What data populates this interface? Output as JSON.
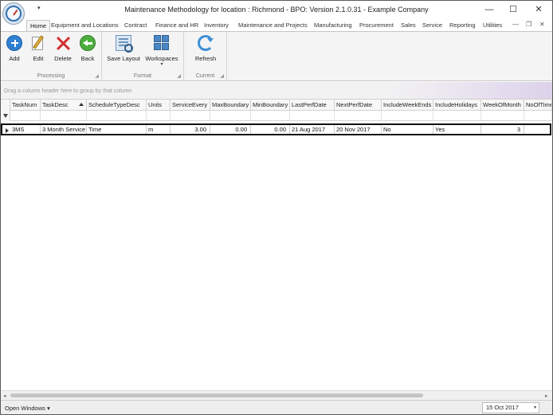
{
  "window": {
    "title": "Maintenance Methodology for location : Richmond - BPO: Version 2.1.0.31 - Example Company",
    "qat_glyph": "▾",
    "controls": {
      "minimize": "—",
      "maximize": "☐",
      "close": "✕"
    }
  },
  "ribbon": {
    "tabs": [
      {
        "label": "Home",
        "active": true
      },
      {
        "label": "Equipment and Locations"
      },
      {
        "label": "Contract"
      },
      {
        "label": "Finance and HR"
      },
      {
        "label": "Inventory"
      },
      {
        "label": "Maintenance and Projects"
      },
      {
        "label": "Manufacturing"
      },
      {
        "label": "Procurement"
      },
      {
        "label": "Sales"
      },
      {
        "label": "Service"
      },
      {
        "label": "Reporting"
      },
      {
        "label": "Utilities"
      }
    ],
    "mdi_controls": {
      "minimize": "—",
      "restore": "❐",
      "close": "✕"
    },
    "groups": {
      "processing": {
        "label": "Processing",
        "buttons": {
          "add": "Add",
          "edit": "Edit",
          "delete": "Delete",
          "back": "Back"
        }
      },
      "format": {
        "label": "Format",
        "buttons": {
          "save_layout": "Save Layout",
          "workspaces": "Workspaces"
        }
      },
      "current": {
        "label": "Current",
        "buttons": {
          "refresh": "Refresh"
        }
      }
    }
  },
  "grid": {
    "group_prompt": "Drag a column header here to group by that column",
    "columns": [
      {
        "key": "tasknum",
        "label": "TaskNum"
      },
      {
        "key": "taskdesc",
        "label": "TaskDesc",
        "sorted": "asc"
      },
      {
        "key": "scheduletype",
        "label": "ScheduleTypeDesc"
      },
      {
        "key": "units",
        "label": "Units"
      },
      {
        "key": "serviceevery",
        "label": "ServiceEvery"
      },
      {
        "key": "maxboundary",
        "label": "MaxBoundary"
      },
      {
        "key": "minboundary",
        "label": "MinBoundary"
      },
      {
        "key": "lastperf",
        "label": "LastPerfDate"
      },
      {
        "key": "nextperf",
        "label": "NextPerfDate"
      },
      {
        "key": "weekends",
        "label": "IncludeWeekEnds"
      },
      {
        "key": "holidays",
        "label": "IncludeHolidays"
      },
      {
        "key": "weekofmonth",
        "label": "WeekOfMonth"
      },
      {
        "key": "nooftimes",
        "label": "NoOfTime"
      }
    ],
    "rows": [
      {
        "cells": [
          "3MS",
          "3 Month Service",
          "Time",
          "m",
          "3.00",
          "0.00",
          "0.00",
          "21 Aug 2017",
          "20 Nov 2017",
          "No",
          "Yes",
          "3",
          ""
        ]
      }
    ]
  },
  "scrollbar": {
    "left": "◂",
    "right": "▸"
  },
  "statusbar": {
    "open_windows": "Open Windows ▾",
    "date": "15 Oct 2017",
    "date_dropdown": "▾"
  }
}
